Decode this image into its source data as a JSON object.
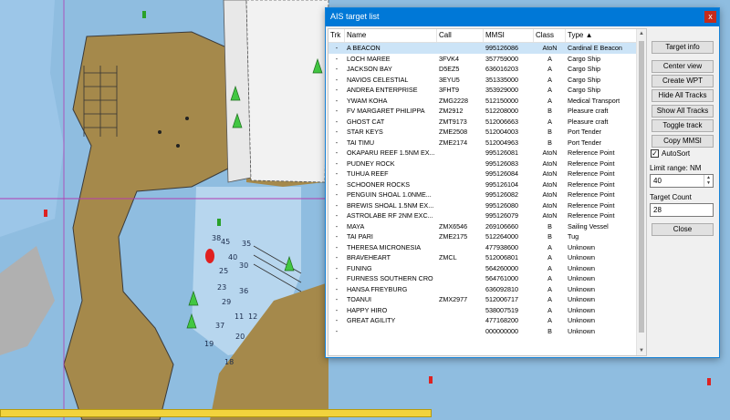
{
  "window": {
    "title": "AIS target list",
    "close_glyph": "x",
    "columns": [
      "Trk",
      "Name",
      "Call",
      "MMSI",
      "Class",
      "Type ▲"
    ],
    "rows": [
      {
        "trk": "-",
        "name": "A BEACON",
        "call": "",
        "mmsi": "995126086",
        "cls": "AtoN",
        "type": "Cardinal E Beacon"
      },
      {
        "trk": "-",
        "name": "LOCH MAREE",
        "call": "3FVK4",
        "mmsi": "357759000",
        "cls": "A",
        "type": "Cargo Ship"
      },
      {
        "trk": "-",
        "name": "JACKSON BAY",
        "call": "D5EZ5",
        "mmsi": "636016203",
        "cls": "A",
        "type": "Cargo Ship"
      },
      {
        "trk": "-",
        "name": "NAVIOS CELESTIAL",
        "call": "3EYU5",
        "mmsi": "351335000",
        "cls": "A",
        "type": "Cargo Ship"
      },
      {
        "trk": "-",
        "name": "ANDREA ENTERPRISE",
        "call": "3FHT9",
        "mmsi": "353929000",
        "cls": "A",
        "type": "Cargo Ship"
      },
      {
        "trk": "-",
        "name": "YWAM KOHA",
        "call": "ZMG2228",
        "mmsi": "512150000",
        "cls": "A",
        "type": "Medical Transport"
      },
      {
        "trk": "-",
        "name": "FV MARGARET PHILIPPA",
        "call": "ZM2912",
        "mmsi": "512208000",
        "cls": "B",
        "type": "Pleasure craft"
      },
      {
        "trk": "-",
        "name": "GHOST CAT",
        "call": "ZMT9173",
        "mmsi": "512006663",
        "cls": "A",
        "type": "Pleasure craft"
      },
      {
        "trk": "-",
        "name": "STAR KEYS",
        "call": "ZME2508",
        "mmsi": "512004003",
        "cls": "B",
        "type": "Port Tender"
      },
      {
        "trk": "-",
        "name": "TAI TIMU",
        "call": "ZME2174",
        "mmsi": "512004963",
        "cls": "B",
        "type": "Port Tender"
      },
      {
        "trk": "-",
        "name": "OKAPARU REEF 1.5NM EX...",
        "call": "",
        "mmsi": "995126081",
        "cls": "AtoN",
        "type": "Reference Point"
      },
      {
        "trk": "-",
        "name": "PUDNEY ROCK",
        "call": "",
        "mmsi": "995126083",
        "cls": "AtoN",
        "type": "Reference Point"
      },
      {
        "trk": "-",
        "name": "TUHUA REEF",
        "call": "",
        "mmsi": "995126084",
        "cls": "AtoN",
        "type": "Reference Point"
      },
      {
        "trk": "-",
        "name": "SCHOONER ROCKS",
        "call": "",
        "mmsi": "995126104",
        "cls": "AtoN",
        "type": "Reference Point"
      },
      {
        "trk": "-",
        "name": "PENGUIN SHOAL 1.0NME...",
        "call": "",
        "mmsi": "995126082",
        "cls": "AtoN",
        "type": "Reference Point"
      },
      {
        "trk": "-",
        "name": "BREWIS SHOAL 1.5NM EX...",
        "call": "",
        "mmsi": "995126080",
        "cls": "AtoN",
        "type": "Reference Point"
      },
      {
        "trk": "-",
        "name": "ASTROLABE RF 2NM EXC...",
        "call": "",
        "mmsi": "995126079",
        "cls": "AtoN",
        "type": "Reference Point"
      },
      {
        "trk": "-",
        "name": "MAYA",
        "call": "ZMX6546",
        "mmsi": "269106660",
        "cls": "B",
        "type": "Sailing Vessel"
      },
      {
        "trk": "-",
        "name": "TAI PARI",
        "call": "ZME2175",
        "mmsi": "512264000",
        "cls": "B",
        "type": "Tug"
      },
      {
        "trk": "-",
        "name": "THERESA MICRONESIA",
        "call": "",
        "mmsi": "477938600",
        "cls": "A",
        "type": "Unknown"
      },
      {
        "trk": "-",
        "name": "BRAVEHEART",
        "call": "ZMCL",
        "mmsi": "512006801",
        "cls": "A",
        "type": "Unknown"
      },
      {
        "trk": "-",
        "name": "FUNING",
        "call": "",
        "mmsi": "564260000",
        "cls": "A",
        "type": "Unknown"
      },
      {
        "trk": "-",
        "name": "FURNESS SOUTHERN CRO",
        "call": "",
        "mmsi": "564761000",
        "cls": "A",
        "type": "Unknown"
      },
      {
        "trk": "-",
        "name": "HANSA FREYBURG",
        "call": "",
        "mmsi": "636092810",
        "cls": "A",
        "type": "Unknown"
      },
      {
        "trk": "-",
        "name": "TOANUI",
        "call": "ZMX2977",
        "mmsi": "512006717",
        "cls": "A",
        "type": "Unknown"
      },
      {
        "trk": "-",
        "name": "HAPPY HIRO",
        "call": "",
        "mmsi": "538007519",
        "cls": "A",
        "type": "Unknown"
      },
      {
        "trk": "-",
        "name": "GREAT AGILITY",
        "call": "",
        "mmsi": "477168200",
        "cls": "A",
        "type": "Unknown"
      },
      {
        "trk": "-",
        "name": "",
        "call": "",
        "mmsi": "000000000",
        "cls": "B",
        "type": "Unknown"
      }
    ],
    "buttons": {
      "target_info": "Target info",
      "center_view": "Center view",
      "create_wpt": "Create WPT",
      "hide_all_tracks": "Hide All Tracks",
      "show_all_tracks": "Show All Tracks",
      "toggle_track": "Toggle track",
      "copy_mmsi": "Copy MMSI",
      "close": "Close"
    },
    "autosort_label": "AutoSort",
    "autosort_checked": true,
    "limit_range_label": "Limit range: NM",
    "limit_range_value": "40",
    "target_count_label": "Target Count",
    "target_count_value": "28"
  },
  "chart": {
    "depth_soundings": [
      "38",
      "45",
      "35",
      "40",
      "30",
      "25",
      "23",
      "36",
      "29",
      "11",
      "12",
      "37",
      "20",
      "19",
      "18"
    ],
    "colors": {
      "water": "#8fbde0",
      "shallow": "#b7d6ee",
      "land": "#a5894b",
      "berth": "#e8e8e8",
      "window_title": "#0078d7"
    }
  }
}
